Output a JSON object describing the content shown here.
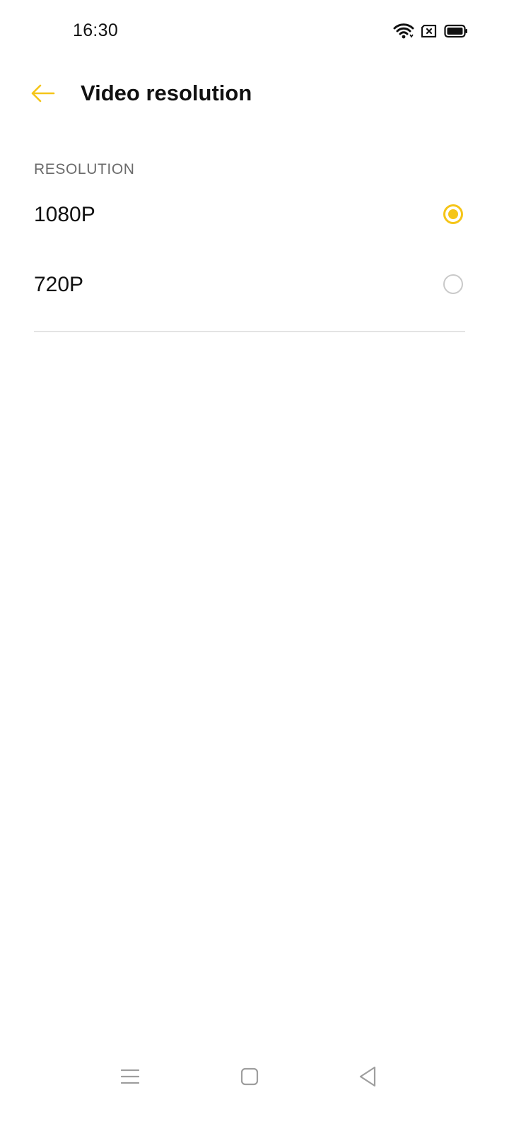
{
  "status_bar": {
    "time": "16:30",
    "icons": [
      "wifi-icon",
      "sim-card-icon",
      "battery-icon"
    ]
  },
  "app_bar": {
    "back_icon": "arrow-left-icon",
    "title": "Video resolution"
  },
  "section": {
    "header": "RESOLUTION",
    "options": [
      {
        "label": "1080P",
        "selected": true
      },
      {
        "label": "720P",
        "selected": false
      }
    ]
  },
  "nav_bar": {
    "icons": [
      "menu-icon",
      "home-square-icon",
      "back-triangle-icon"
    ]
  },
  "colors": {
    "accent": "#f5c518",
    "background": "#ffffff",
    "text_primary": "#111111",
    "text_secondary": "#6b6b6b",
    "divider": "#e3e3e3",
    "radio_unchecked": "#c9c9c9",
    "nav_icon": "#9e9e9e"
  }
}
